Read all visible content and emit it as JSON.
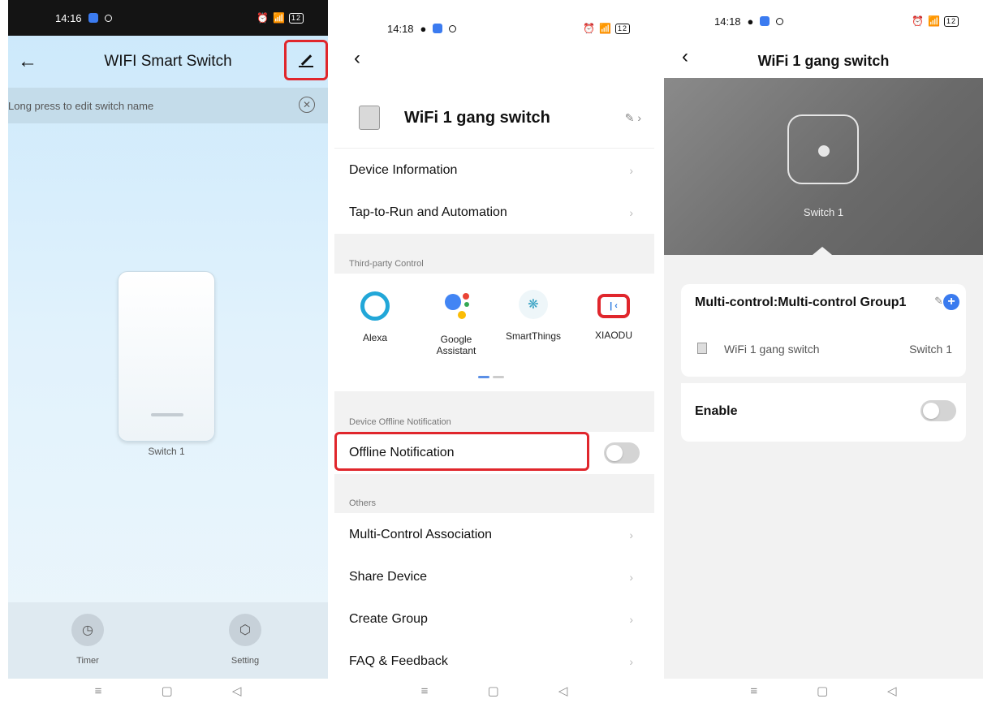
{
  "panel1": {
    "status": {
      "time": "14:16",
      "battery": "12"
    },
    "header": {
      "title": "WIFI Smart Switch"
    },
    "hint": "Long press to edit switch name",
    "switch_label": "Switch 1",
    "bottom": {
      "timer": "Timer",
      "setting": "Setting"
    }
  },
  "panel2": {
    "status": {
      "time": "14:18",
      "battery": "12"
    },
    "device_name": "WiFi 1 gang switch",
    "rows_top": [
      "Device Information",
      "Tap-to-Run and Automation"
    ],
    "section_third_party": "Third-party Control",
    "third_party": [
      {
        "name": "Alexa",
        "icon": "alexa-icon"
      },
      {
        "name": "Google\nAssistant",
        "icon": "google-assistant-icon"
      },
      {
        "name": "SmartThings",
        "icon": "smartthings-icon"
      },
      {
        "name": "XIAODU",
        "icon": "xiaodu-icon"
      }
    ],
    "section_offline": "Device Offline Notification",
    "offline_label": "Offline Notification",
    "section_others": "Others",
    "rows_others": [
      "Multi-Control Association",
      "Share Device",
      "Create Group",
      "FAQ & Feedback"
    ]
  },
  "panel3": {
    "status": {
      "time": "14:18",
      "battery": "12"
    },
    "title": "WiFi 1 gang switch",
    "hero_label": "Switch 1",
    "group_title": "Multi-control:Multi-control Group1",
    "group_device": "WiFi 1 gang switch",
    "group_switch": "Switch 1",
    "enable_label": "Enable"
  },
  "colors": {
    "highlight": "#e0262c",
    "accent": "#3a7bef"
  }
}
